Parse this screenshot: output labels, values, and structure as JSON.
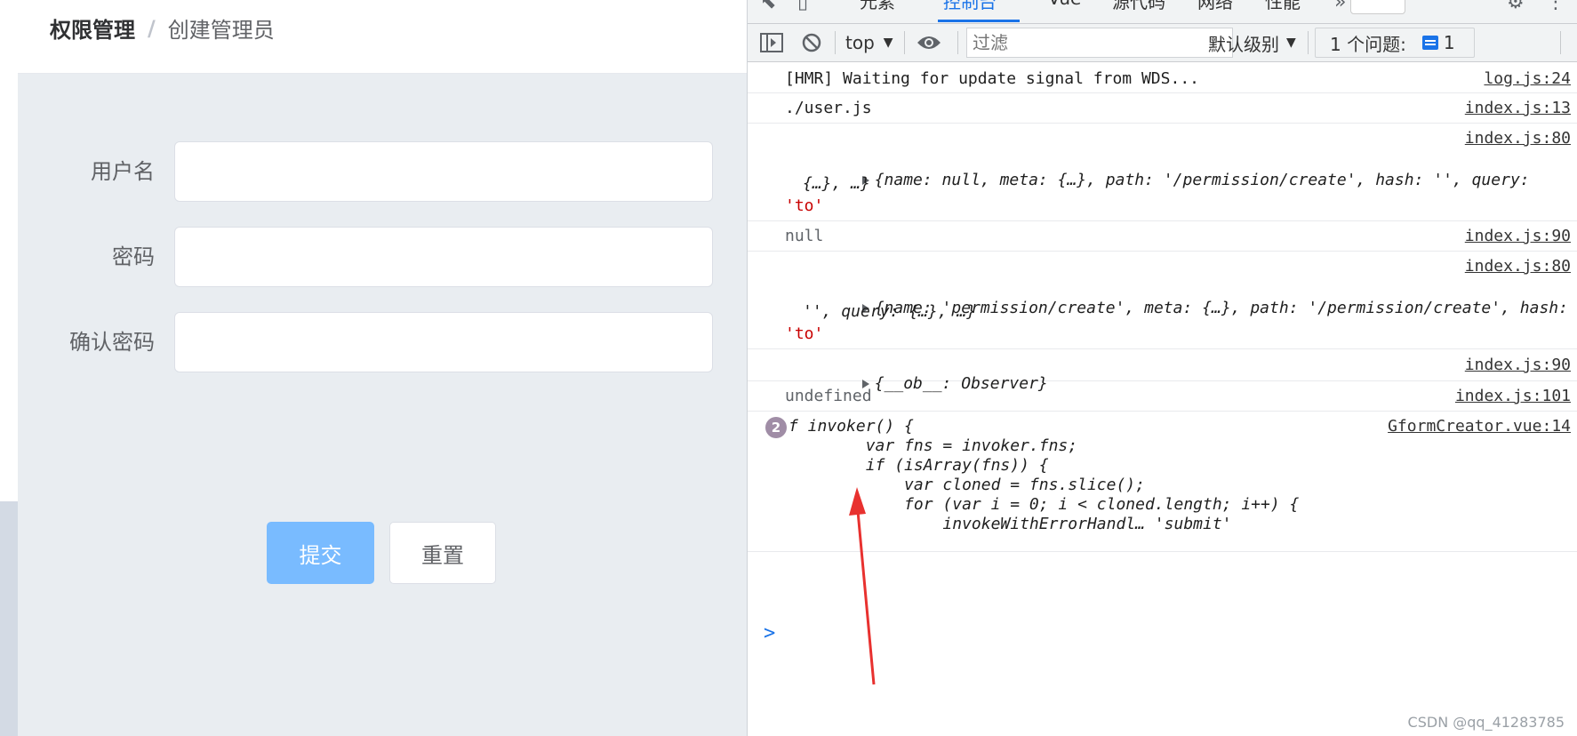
{
  "app": {
    "breadcrumb": {
      "parent": "权限管理",
      "separator": "/",
      "current": "创建管理员"
    },
    "form": {
      "fields": [
        {
          "label": "用户名",
          "value": ""
        },
        {
          "label": "密码",
          "value": ""
        },
        {
          "label": "确认密码",
          "value": ""
        }
      ],
      "submit_label": "提交",
      "reset_label": "重置"
    }
  },
  "devtools": {
    "tabs": [
      "元素",
      "控制台",
      "Vue",
      "源代码",
      "网络",
      "性能"
    ],
    "active_tab": "控制台",
    "toolbar": {
      "context": "top",
      "filter_placeholder": "过滤",
      "level": "默认级别",
      "issues_label": "1 个问题:",
      "issues_count": "1"
    },
    "console": {
      "logs": [
        {
          "message": "[HMR] Waiting for update signal from WDS...",
          "source": "log.js:24"
        },
        {
          "message": "./user.js",
          "source": "index.js:13"
        },
        {
          "source": "index.js:80",
          "object_line1": "{name: null, meta: {…}, path: '/permission/create', hash: '', query:",
          "object_line2": "{…}, …}",
          "tail": "'to'"
        },
        {
          "message": "null",
          "source": "index.js:90"
        },
        {
          "source": "index.js:80",
          "object_line1": "{name: 'permission/create', meta: {…}, path: '/permission/create', hash:",
          "object_line2": "'', query: {…}, …}",
          "tail": "'to'"
        },
        {
          "message": "{__ob__: Observer}",
          "source": "index.js:90"
        },
        {
          "message": "undefined",
          "source": "index.js:101"
        },
        {
          "source": "GformCreator.vue:14",
          "repeat": "2",
          "code": [
            "f invoker() {",
            "        var fns = invoker.fns;",
            "        if (isArray(fns)) {",
            "            var cloned = fns.slice();",
            "            for (var i = 0; i < cloned.length; i++) {",
            "                invokeWithErrorHandl… 'submit'"
          ]
        }
      ],
      "prompt": ">"
    }
  },
  "watermark": "CSDN @qq_41283785",
  "colors": {
    "accent": "#1a73e8",
    "submit": "#79bbff",
    "arrow": "#e8312f",
    "string": "#c80000"
  }
}
